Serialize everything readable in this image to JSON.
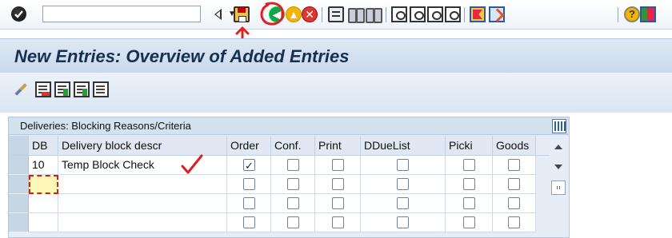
{
  "toolbar": {
    "command_field_value": "",
    "command_field_placeholder": "",
    "icons": [
      "enter-check",
      "command-field-dropdown",
      "triangle-left",
      "save",
      "back",
      "exit",
      "cancel",
      "print",
      "find",
      "find-next",
      "first-page",
      "previous-page",
      "next-page",
      "last-page",
      "create-session",
      "generate-shortcut",
      "help",
      "customize-layout"
    ],
    "help_glyph": "?"
  },
  "title_bar": {
    "title": "New Entries: Overview of Added Entries"
  },
  "app_toolbar": {
    "icons": [
      "edit-pencil",
      "delete-row",
      "select-all",
      "select-block",
      "deselect-all"
    ]
  },
  "table": {
    "title": "Deliveries: Blocking Reasons/Criteria",
    "headers": [
      "DB",
      "Delivery block descr",
      "Order",
      "Conf.",
      "Print",
      "DDueList",
      "Picki",
      "Goods"
    ],
    "rows": [
      {
        "db": "10",
        "descr": "Temp Block Check",
        "order": true,
        "conf": false,
        "print": false,
        "ddue": false,
        "picki": false,
        "goods": false
      },
      {
        "db": "",
        "descr": "",
        "order": false,
        "conf": false,
        "print": false,
        "ddue": false,
        "picki": false,
        "goods": false
      },
      {
        "db": "",
        "descr": "",
        "order": false,
        "conf": false,
        "print": false,
        "ddue": false,
        "picki": false,
        "goods": false
      },
      {
        "db": "",
        "descr": "",
        "order": false,
        "conf": false,
        "print": false,
        "ddue": false,
        "picki": false,
        "goods": false
      }
    ]
  },
  "annotation_color": "#e02020",
  "accent_colors": {
    "title_text": "#17304f",
    "toolbar_bg": "#eef3f9",
    "panel_bg": "#e5edf6"
  }
}
